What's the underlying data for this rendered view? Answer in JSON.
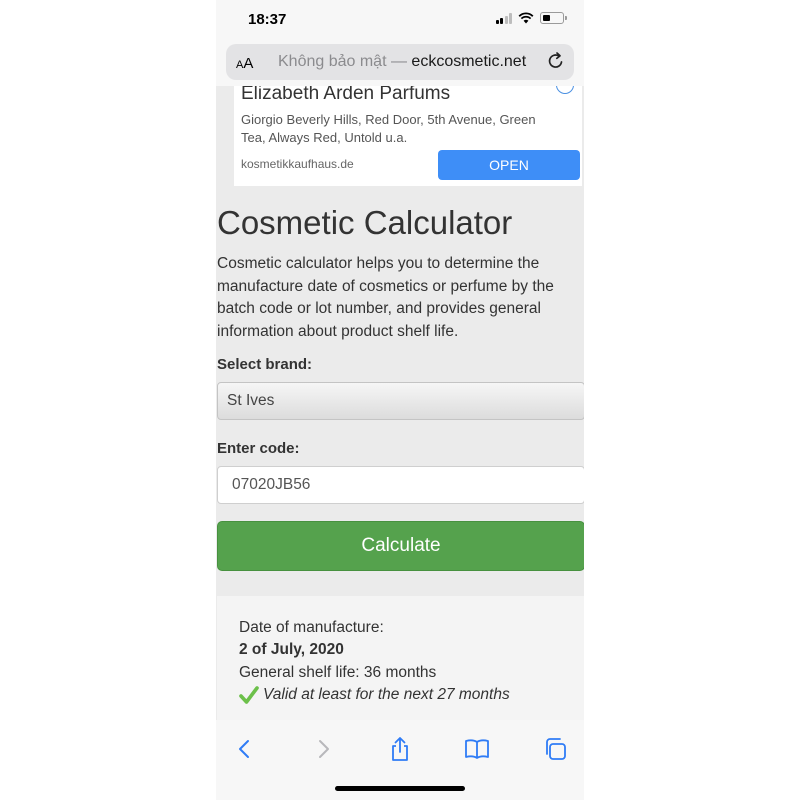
{
  "status_bar": {
    "time": "18:37"
  },
  "address_bar": {
    "aa_label": "AA",
    "security_text": "Không bảo mật — ",
    "domain": "eckcosmetic.net"
  },
  "ad": {
    "title": "Elizabeth Arden Parfums",
    "description": "Giorgio Beverly Hills, Red Door, 5th Avenue, Green Tea, Always Red, Untold u.a.",
    "domain": "kosmetikkaufhaus.de",
    "open_label": "OPEN",
    "button_color": "#3e8ef7"
  },
  "page": {
    "title": "Cosmetic Calculator",
    "intro": "Cosmetic calculator helps you to determine the manufacture date of cosmetics or perfume by the batch code or lot number, and provides general information about product shelf life."
  },
  "form": {
    "brand_label": "Select brand:",
    "brand_value": "St Ives",
    "code_label": "Enter code:",
    "code_value": "07020JB56",
    "calculate_label": "Calculate",
    "calculate_color": "#55a24d"
  },
  "result": {
    "manufacture_label": "Date of manufacture:",
    "manufacture_date": "2 of July, 2020",
    "shelf_life": "General shelf life: 36 months",
    "validity": "Valid at least for the next 27 months",
    "check_color": "#6cc04a"
  },
  "toolbar": {
    "icons": [
      "back-icon",
      "forward-icon",
      "share-icon",
      "bookmarks-icon",
      "tabs-icon"
    ],
    "accent": "#2f7cf6"
  }
}
